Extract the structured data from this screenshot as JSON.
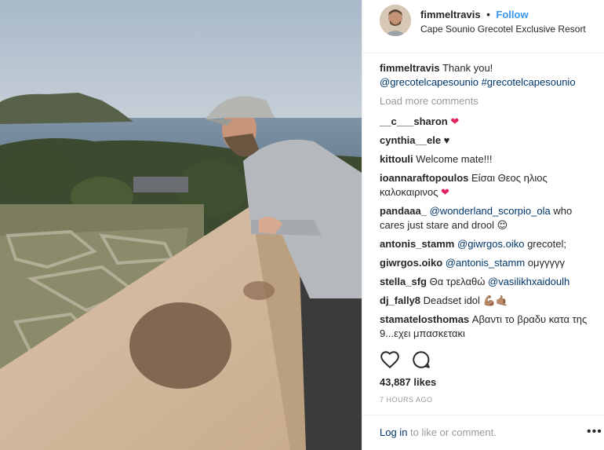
{
  "header": {
    "username": "fimmeltravis",
    "separator": "•",
    "follow_label": "Follow",
    "location": "Cape Sounio Grecotel Exclusive Resort"
  },
  "caption": {
    "user": "fimmeltravis",
    "text": "Thank you!",
    "tag1": "@grecotelcapesounio",
    "tag2": "#grecotelcapesounio"
  },
  "load_more": "Load more comments",
  "comments": [
    {
      "user": "__c___sharon",
      "text": "",
      "emoji": "❤"
    },
    {
      "user": "cynthia__ele",
      "text": "♥"
    },
    {
      "user": "kittouli",
      "text": "Welcome mate!!!"
    },
    {
      "user": "ioannaraftopoulos",
      "text": "Είσαι Θεος ηλιος καλοκαιρινος",
      "emoji": "❤"
    },
    {
      "user": "pandaaa_",
      "mention": "@wonderland_scorpio_ola",
      "text": "who cares just stare and drool",
      "emoji": "😌"
    },
    {
      "user": "antonis_stamm",
      "mention": "@giwrgos.oiko",
      "text": "grecotel;"
    },
    {
      "user": "giwrgos.oiko",
      "mention": "@antonis_stamm",
      "text": "ομγγγγγ"
    },
    {
      "user": "stella_sfg",
      "text": "Θα τρελαθώ",
      "mention": "@vasilikhxaidoulh"
    },
    {
      "user": "dj_fally8",
      "text": "Deadset idol",
      "emoji": "💪🏽🤙🏽"
    },
    {
      "user": "stamatelosthomas",
      "text": "Αβαντι το βραδυ κατα της 9...εχει μπασκετακι"
    }
  ],
  "likes": "43,887 likes",
  "time_ago": "7 HOURS AGO",
  "footer": {
    "login_label": "Log in",
    "login_suffix": " to like or comment.",
    "more": "•••"
  },
  "colors": {
    "accent": "#3897f0",
    "mention": "#003569",
    "muted": "#999999",
    "heart": "#e0245e"
  },
  "icons": [
    "heart-outline-icon",
    "comment-bubble-icon",
    "more-options-icon"
  ]
}
